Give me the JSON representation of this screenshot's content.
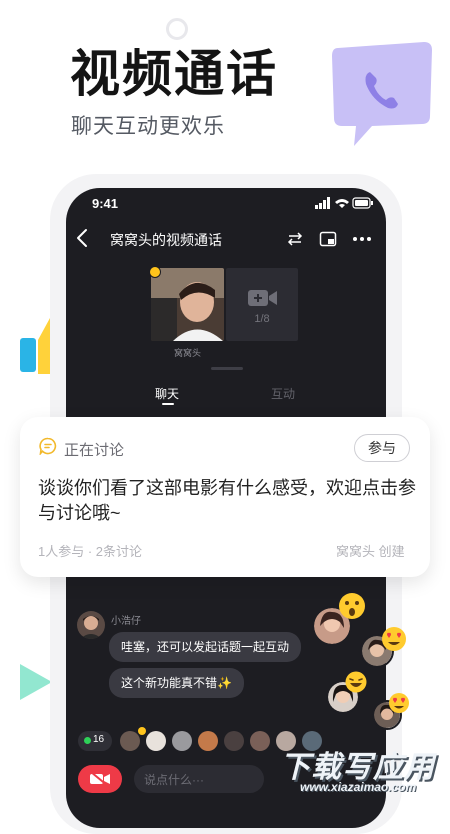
{
  "promo": {
    "headline": "视频通话",
    "subline": "聊天互动更欢乐"
  },
  "status_bar": {
    "time": "9:41"
  },
  "nav": {
    "title": "窝窝头的视频通话"
  },
  "video": {
    "speaker_name": "窝窝头",
    "empty_slot_count": "1/8"
  },
  "tabs": [
    {
      "label": "聊天",
      "active": true
    },
    {
      "label": "互动",
      "active": false
    }
  ],
  "card": {
    "status": "正在讨论",
    "join_label": "参与",
    "topic": "谈谈你们看了这部电影有什么感受，欢迎点击参与讨论哦~",
    "meta": "1人参与 · 2条讨论",
    "creator": "窝窝头 创建"
  },
  "chat": {
    "sender": "小浩仔",
    "messages": [
      "哇塞，还可以发起话题一起互动",
      "这个新功能真不错✨"
    ]
  },
  "bottom": {
    "online_count": "16",
    "input_placeholder": "说点什么···"
  },
  "watermark": {
    "main": "下载写应用",
    "sub": "www.xiazaimao.com"
  },
  "colors": {
    "accent_red": "#ee3a47",
    "speaking_yellow": "#ffc41c",
    "online_green": "#2ed158",
    "bubble_purple": "#c8c0f6",
    "phone_bg": "#1d1d22"
  }
}
